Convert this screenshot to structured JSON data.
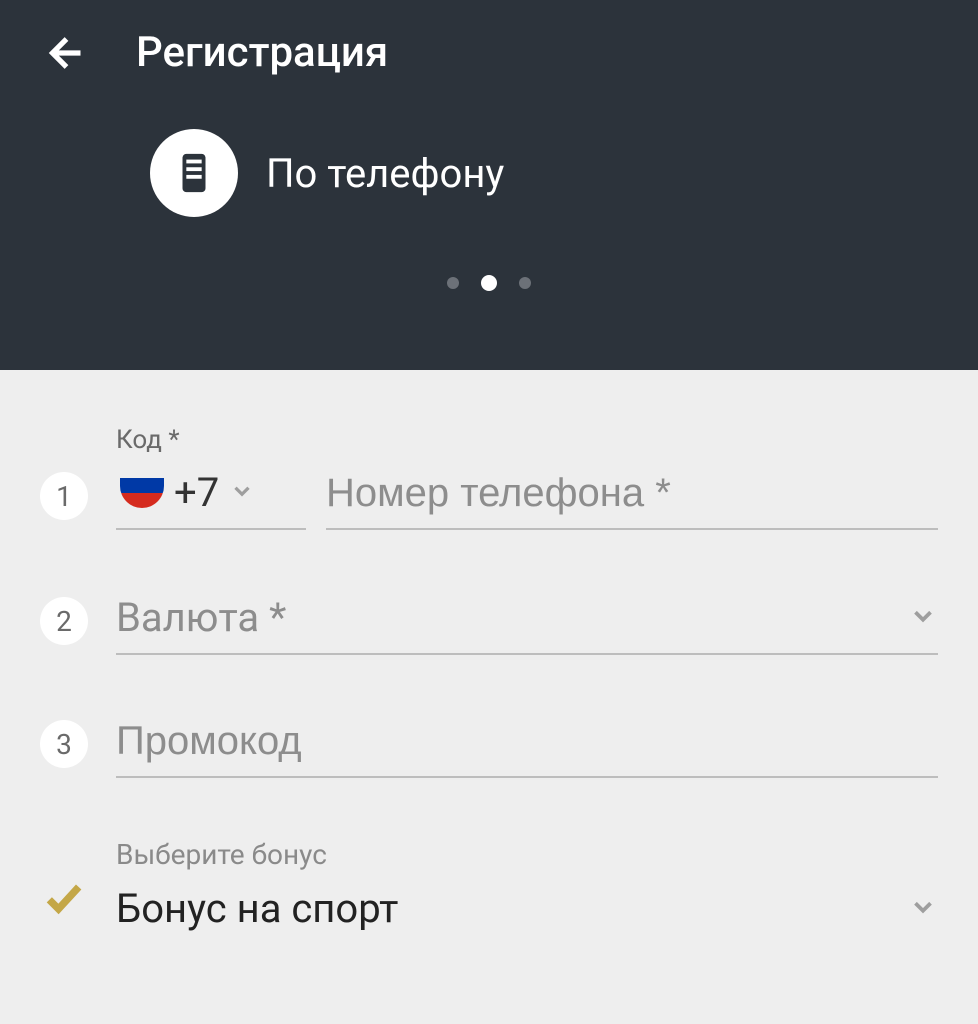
{
  "header": {
    "title": "Регистрация",
    "method_label": "По телефону"
  },
  "pager": {
    "count": 3,
    "active_index": 1
  },
  "steps": {
    "s1": "1",
    "s2": "2",
    "s3": "3"
  },
  "phone": {
    "code_label": "Код *",
    "code_value": "+7",
    "number_placeholder": "Номер телефона *"
  },
  "currency": {
    "placeholder": "Валюта *"
  },
  "promo": {
    "placeholder": "Промокод"
  },
  "bonus": {
    "label": "Выберите бонус",
    "value": "Бонус на спорт"
  }
}
